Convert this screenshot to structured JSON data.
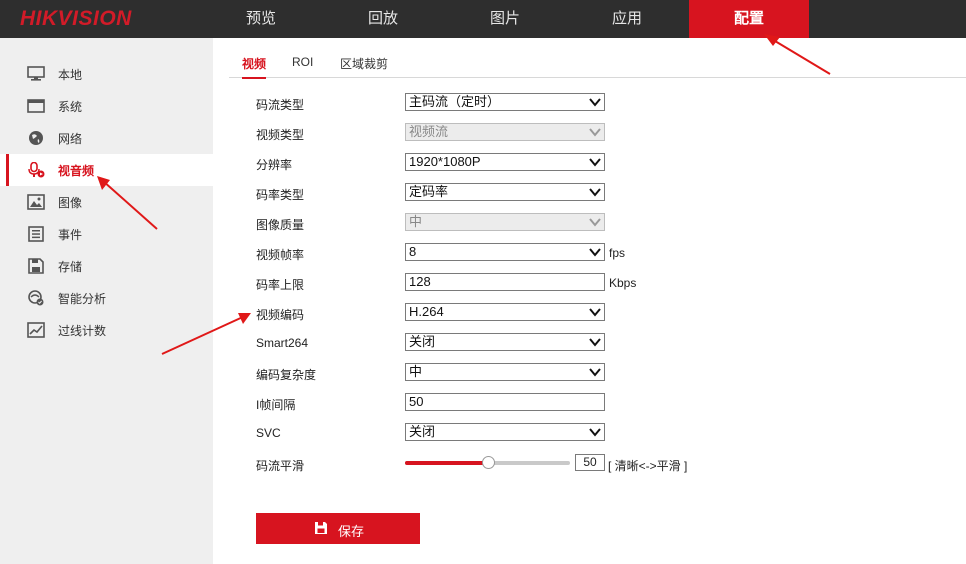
{
  "brand": {
    "logo_text": "HIKVISION",
    "accent": "#d7141f"
  },
  "top_nav": {
    "items": [
      {
        "label": "预览"
      },
      {
        "label": "回放"
      },
      {
        "label": "图片"
      },
      {
        "label": "应用"
      },
      {
        "label": "配置",
        "active": true
      }
    ]
  },
  "sidebar": {
    "items": [
      {
        "label": "本地",
        "icon": "monitor-icon"
      },
      {
        "label": "系统",
        "icon": "system-icon"
      },
      {
        "label": "网络",
        "icon": "globe-icon"
      },
      {
        "label": "视音频",
        "icon": "microphone-icon",
        "active": true
      },
      {
        "label": "图像",
        "icon": "image-icon"
      },
      {
        "label": "事件",
        "icon": "event-list-icon"
      },
      {
        "label": "存储",
        "icon": "storage-icon"
      },
      {
        "label": "智能分析",
        "icon": "smart-analysis-icon"
      },
      {
        "label": "过线计数",
        "icon": "line-counting-icon"
      }
    ]
  },
  "tabs": [
    {
      "label": "视频",
      "active": true
    },
    {
      "label": "ROI"
    },
    {
      "label": "区域裁剪"
    }
  ],
  "form": {
    "stream_type": {
      "label": "码流类型",
      "value": "主码流（定时）"
    },
    "video_type": {
      "label": "视频类型",
      "value": "视频流",
      "disabled": true
    },
    "resolution": {
      "label": "分辨率",
      "value": "1920*1080P"
    },
    "bitrate_type": {
      "label": "码率类型",
      "value": "定码率"
    },
    "image_quality": {
      "label": "图像质量",
      "value": "中",
      "disabled": true
    },
    "frame_rate": {
      "label": "视频帧率",
      "value": "8",
      "unit": "fps"
    },
    "max_bitrate": {
      "label": "码率上限",
      "value": "128",
      "unit": "Kbps"
    },
    "video_encoding": {
      "label": "视频编码",
      "value": "H.264"
    },
    "smart264": {
      "label": "Smart264",
      "value": "关闭"
    },
    "encoding_complexity": {
      "label": "编码复杂度",
      "value": "中"
    },
    "i_frame_interval": {
      "label": "I帧间隔",
      "value": "50"
    },
    "svc": {
      "label": "SVC",
      "value": "关闭"
    },
    "stream_smoothing": {
      "label": "码流平滑",
      "value": 50,
      "value_text": "50",
      "hint": "[ 清晰<->平滑 ]"
    }
  },
  "actions": {
    "save_label": "保存"
  }
}
